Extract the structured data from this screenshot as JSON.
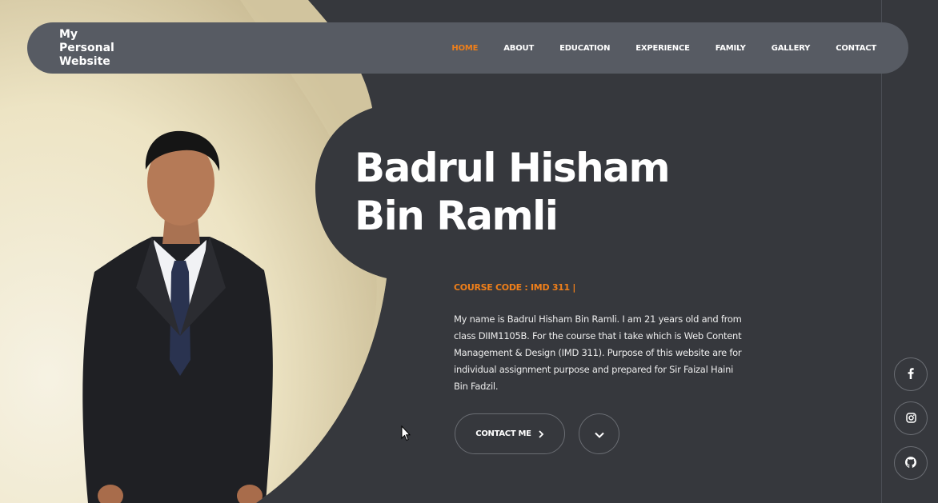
{
  "header": {
    "brand": "My Personal Website"
  },
  "nav": {
    "items": [
      {
        "label": "HOME",
        "active": true
      },
      {
        "label": "ABOUT",
        "active": false
      },
      {
        "label": "EDUCATION",
        "active": false
      },
      {
        "label": "EXPERIENCE",
        "active": false
      },
      {
        "label": "FAMILY",
        "active": false
      },
      {
        "label": "GALLERY",
        "active": false
      },
      {
        "label": "CONTACT",
        "active": false
      }
    ]
  },
  "hero": {
    "name_line1": "Badrul Hisham",
    "name_line2": "Bin Ramli",
    "course_code": "COURSE CODE : IMD 311 |",
    "intro": "My name is Badrul Hisham Bin Ramli. I am 21 years old and from class DIIM1105B. For the course that i take which is Web Content Management & Design (IMD 311). Purpose of this website are for individual assignment purpose and prepared for Sir Faizal Haini Bin Fadzil.",
    "contact_label": "CONTACT ME",
    "contact_icon": "chevron-right-icon",
    "scroll_icon": "chevron-down-icon"
  },
  "social": [
    "facebook-icon",
    "instagram-icon",
    "github-icon"
  ],
  "colors": {
    "background": "#36383d",
    "navbar": "#575b63",
    "accent": "#ef7f1a",
    "text": "#ffffff"
  }
}
